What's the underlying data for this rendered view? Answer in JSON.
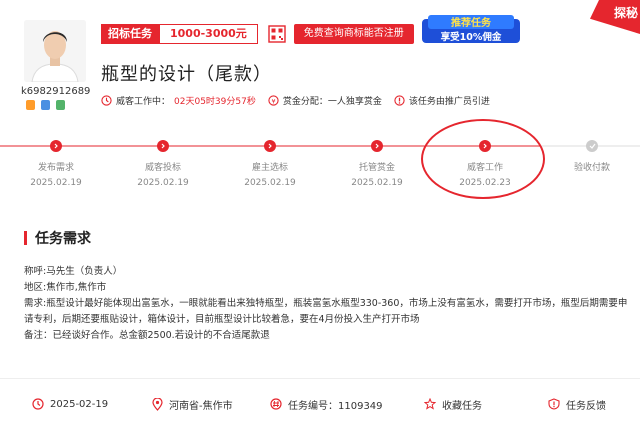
{
  "corner_ribbon": "探秘",
  "user": {
    "id": "k6982912689"
  },
  "tags": {
    "bid_type": "招标任务",
    "price_range": "1000-3000元",
    "free_query": "免费查询商标能否注册",
    "promo_line1": "推荐任务",
    "promo_line2": "享受10%佣金"
  },
  "task": {
    "title": "瓶型的设计（尾款）",
    "status_label": "威客工作中：",
    "countdown": "02天05时39分57秒",
    "reward_label": "赏金分配：一人独享赏金",
    "referral": "该任务由推广员引进"
  },
  "steps": [
    {
      "label": "发布需求",
      "date": "2025.02.19"
    },
    {
      "label": "威客投标",
      "date": "2025.02.19"
    },
    {
      "label": "雇主选标",
      "date": "2025.02.19"
    },
    {
      "label": "托管赏金",
      "date": "2025.02.19"
    },
    {
      "label": "威客工作",
      "date": "2025.02.23"
    },
    {
      "label": "验收付款",
      "date": ""
    }
  ],
  "requirements": {
    "heading": "任务需求",
    "contact": "称呼:马先生（负责人）",
    "region": "地区:焦作市,焦作市",
    "description": "需求:瓶型设计最好能体现出富氢水，一眼就能看出来独特瓶型，瓶装富氢水瓶型330-360，市场上没有富氢水，需要打开市场，瓶型后期需要申请专利，后期还要瓶贴设计，箱体设计，目前瓶型设计比较着急，要在4月份投入生产打开市场",
    "note": "备注：已经谈好合作。总金额2500.若设计的不合适尾款退"
  },
  "footer": {
    "date": "2025-02-19",
    "location": "河南省-焦作市",
    "task_number": "任务编号：1109349",
    "favorite": "收藏任务",
    "feedback": "任务反馈"
  },
  "colors": {
    "accent": "#e5262e",
    "muted": "#888888",
    "inactive": "#cccccc"
  }
}
